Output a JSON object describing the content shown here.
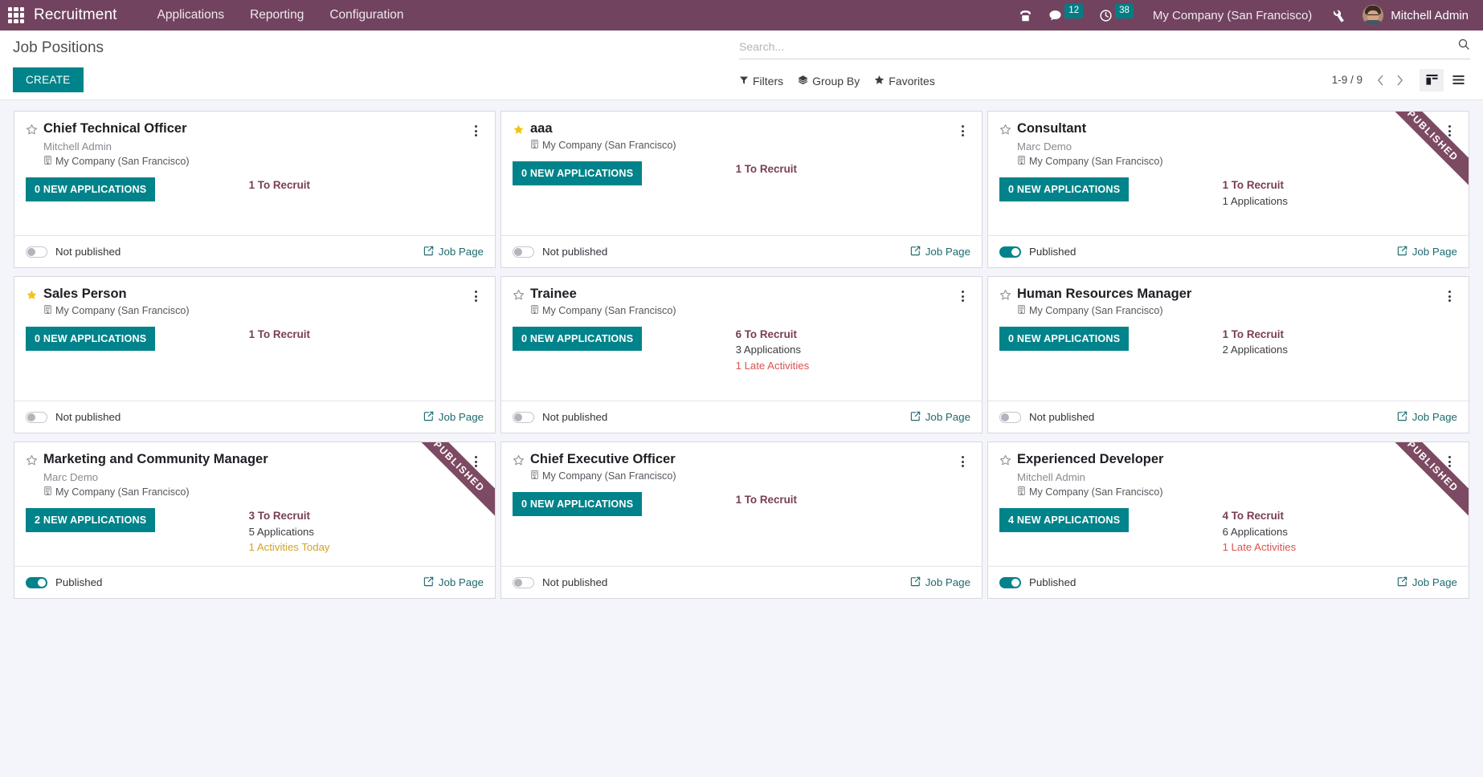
{
  "navbar": {
    "apps_icon": "apps-grid-icon",
    "brand": "Recruitment",
    "menus": [
      {
        "label": "Applications"
      },
      {
        "label": "Reporting"
      },
      {
        "label": "Configuration"
      }
    ],
    "icons": [
      {
        "name": "phone-dialpad-icon",
        "badge": null
      },
      {
        "name": "messages-icon",
        "badge": "12"
      },
      {
        "name": "activities-clock-icon",
        "badge": "38"
      }
    ],
    "company": "My Company (San Francisco)",
    "debug_icon": "wrench-tools-icon",
    "user_name": "Mitchell Admin",
    "avatar_name": "user-avatar",
    "bg_color": "#71435f",
    "badge_color": "#017e84"
  },
  "control_panel": {
    "title": "Job Positions",
    "create_label": "CREATE",
    "search": {
      "placeholder": "Search...",
      "value": "",
      "icon": "search-icon"
    },
    "filters": [
      {
        "label": "Filters",
        "icon": "filter-funnel-icon"
      },
      {
        "label": "Group By",
        "icon": "layers-icon"
      },
      {
        "label": "Favorites",
        "icon": "star-icon"
      }
    ],
    "pager": "1-9 / 9",
    "prev_icon": "chevron-left-icon",
    "next_icon": "chevron-right-icon",
    "views": [
      {
        "name": "kanban-view",
        "icon": "kanban-icon",
        "active": true
      },
      {
        "name": "list-view",
        "icon": "list-icon",
        "active": false
      }
    ],
    "accent_color": "#00838a"
  },
  "labels": {
    "published": "Published",
    "not_published": "Not published",
    "job_page": "Job Page",
    "ribbon": "PUBLISHED",
    "external_link_icon": "external-link-icon",
    "building_icon": "building-icon",
    "kebab_icon": "kebab-menu-icon",
    "star_icon": "star-icon"
  },
  "cards": [
    {
      "title": "Chief Technical Officer",
      "manager": "Mitchell Admin",
      "company": "My Company (San Francisco)",
      "new_applications": "0 NEW APPLICATIONS",
      "to_recruit": "1 To Recruit",
      "applications": "",
      "late_activities": "",
      "activities_today": "",
      "published": false,
      "publish_label": "Not published",
      "favorite": false,
      "ribbon": false
    },
    {
      "title": "aaa",
      "manager": "",
      "company": "My Company (San Francisco)",
      "new_applications": "0 NEW APPLICATIONS",
      "to_recruit": "1 To Recruit",
      "applications": "",
      "late_activities": "",
      "activities_today": "",
      "published": false,
      "publish_label": "Not published",
      "favorite": true,
      "ribbon": false
    },
    {
      "title": "Consultant",
      "manager": "Marc Demo",
      "company": "My Company (San Francisco)",
      "new_applications": "0 NEW APPLICATIONS",
      "to_recruit": "1 To Recruit",
      "applications": "1 Applications",
      "late_activities": "",
      "activities_today": "",
      "published": true,
      "publish_label": "Published",
      "favorite": false,
      "ribbon": true
    },
    {
      "title": "Sales Person",
      "manager": "",
      "company": "My Company (San Francisco)",
      "new_applications": "0 NEW APPLICATIONS",
      "to_recruit": "1 To Recruit",
      "applications": "",
      "late_activities": "",
      "activities_today": "",
      "published": false,
      "publish_label": "Not published",
      "favorite": true,
      "ribbon": false
    },
    {
      "title": "Trainee",
      "manager": "",
      "company": "My Company (San Francisco)",
      "new_applications": "0 NEW APPLICATIONS",
      "to_recruit": "6 To Recruit",
      "applications": "3 Applications",
      "late_activities": "1 Late Activities",
      "activities_today": "",
      "published": false,
      "publish_label": "Not published",
      "favorite": false,
      "ribbon": false
    },
    {
      "title": "Human Resources Manager",
      "manager": "",
      "company": "My Company (San Francisco)",
      "new_applications": "0 NEW APPLICATIONS",
      "to_recruit": "1 To Recruit",
      "applications": "2 Applications",
      "late_activities": "",
      "activities_today": "",
      "published": false,
      "publish_label": "Not published",
      "favorite": false,
      "ribbon": false
    },
    {
      "title": "Marketing and Community Manager",
      "manager": "Marc Demo",
      "company": "My Company (San Francisco)",
      "new_applications": "2 NEW APPLICATIONS",
      "to_recruit": "3 To Recruit",
      "applications": "5 Applications",
      "late_activities": "",
      "activities_today": "1 Activities Today",
      "published": true,
      "publish_label": "Published",
      "favorite": false,
      "ribbon": true
    },
    {
      "title": "Chief Executive Officer",
      "manager": "",
      "company": "My Company (San Francisco)",
      "new_applications": "0 NEW APPLICATIONS",
      "to_recruit": "1 To Recruit",
      "applications": "",
      "late_activities": "",
      "activities_today": "",
      "published": false,
      "publish_label": "Not published",
      "favorite": false,
      "ribbon": false
    },
    {
      "title": "Experienced Developer",
      "manager": "Mitchell Admin",
      "company": "My Company (San Francisco)",
      "new_applications": "4 NEW APPLICATIONS",
      "to_recruit": "4 To Recruit",
      "applications": "6 Applications",
      "late_activities": "1 Late Activities",
      "activities_today": "",
      "published": true,
      "publish_label": "Published",
      "favorite": false,
      "ribbon": true
    }
  ]
}
